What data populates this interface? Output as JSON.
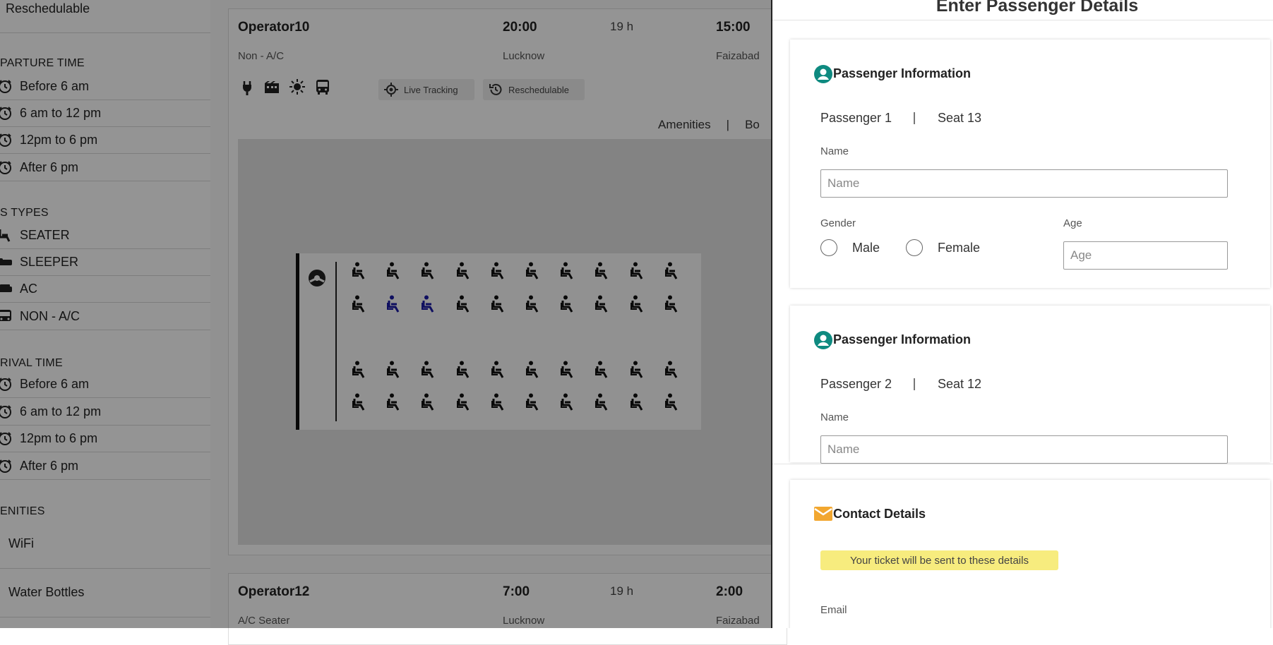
{
  "sidebar": {
    "top_item": "Reschedulable",
    "departure_heading": "PARTURE TIME",
    "departure_items": [
      "Before 6 am",
      "6 am to 12 pm",
      "12pm to 6 pm",
      "After 6 pm"
    ],
    "bus_types_heading": "S TYPES",
    "bus_types": [
      "SEATER",
      "SLEEPER",
      "AC",
      "NON - A/C"
    ],
    "arrival_heading": "RIVAL TIME",
    "arrival_items": [
      "Before 6 am",
      "6 am to 12 pm",
      "12pm to 6 pm",
      "After 6 pm"
    ],
    "amenities_heading": "ENITIES",
    "amenities": [
      "WiFi",
      "Water Bottles"
    ]
  },
  "bus_card_1": {
    "operator": "Operator10",
    "bus_type": "Non - A/C",
    "departure_time": "20:00",
    "duration": "19 h",
    "arrival_time": "15:00",
    "from": "Lucknow",
    "to": "Faizabad",
    "amenity_icons": [
      "plug-icon",
      "movie-icon",
      "lamp-icon",
      "bus-icon"
    ],
    "chips": [
      {
        "label": "Live Tracking",
        "icon": "gps-icon"
      },
      {
        "label": "Reschedulable",
        "icon": "history-icon"
      }
    ],
    "tabs": [
      "Amenities",
      "Bo"
    ],
    "seat_rows": 4,
    "seats_per_row": 10,
    "selected_seats": [
      [
        1,
        1
      ],
      [
        1,
        2
      ]
    ],
    "colors": {
      "seat": "#111111",
      "selected_seat": "#1a1aa6"
    }
  },
  "bus_card_2": {
    "operator": "Operator12",
    "bus_type": "A/C Seater",
    "departure_time": "7:00",
    "duration": "19 h",
    "arrival_time": "2:00",
    "from": "Lucknow",
    "to": "Faizabad"
  },
  "drawer": {
    "title": "Enter Passenger Details",
    "passengers": [
      {
        "heading": "Passenger Information",
        "passenger": "Passenger 1",
        "seat": "Seat 13",
        "name_label": "Name",
        "name_placeholder": "Name",
        "gender_label": "Gender",
        "gender_options": [
          "Male",
          "Female"
        ],
        "age_label": "Age",
        "age_placeholder": "Age"
      },
      {
        "heading": "Passenger Information",
        "passenger": "Passenger 2",
        "seat": "Seat 12",
        "name_label": "Name",
        "name_placeholder": "Name"
      }
    ],
    "contact": {
      "heading": "Contact Details",
      "note": "Your ticket will be sent to these details",
      "email_label": "Email"
    },
    "colors": {
      "accent_teal": "#0e8a80",
      "mail_icon": "#f2a730",
      "note_bg": "#f7ec7e"
    }
  }
}
